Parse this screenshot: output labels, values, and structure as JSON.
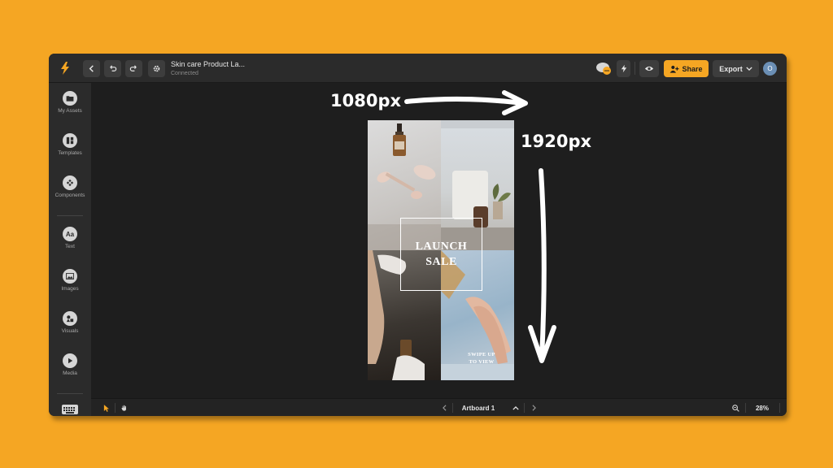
{
  "colors": {
    "background": "#F5A623",
    "accent": "#F5A623",
    "panel": "#2b2b2b",
    "canvas": "#1e1e1e"
  },
  "topbar": {
    "doc_title": "Skin care Product La...",
    "doc_status": "Connected",
    "share_label": "Share",
    "export_label": "Export",
    "avatar_initial": "O"
  },
  "sidebar": {
    "items": [
      {
        "label": "My Assets",
        "icon": "folder-icon"
      },
      {
        "label": "Templates",
        "icon": "templates-icon"
      },
      {
        "label": "Components",
        "icon": "components-icon"
      },
      {
        "label": "Text",
        "icon": "text-icon"
      },
      {
        "label": "Images",
        "icon": "images-icon"
      },
      {
        "label": "Visuals",
        "icon": "visuals-icon"
      },
      {
        "label": "Media",
        "icon": "play-icon"
      }
    ],
    "text_icon_glyph": "Aa"
  },
  "artboard": {
    "headline_line1": "LAUNCH",
    "headline_line2": "SALE",
    "cta_line1": "SWIPE UP",
    "cta_line2": "TO VIEW"
  },
  "bottombar": {
    "artboard_name": "Artboard 1",
    "zoom": "28%"
  },
  "annotations": {
    "width_label": "1080px",
    "height_label": "1920px"
  }
}
